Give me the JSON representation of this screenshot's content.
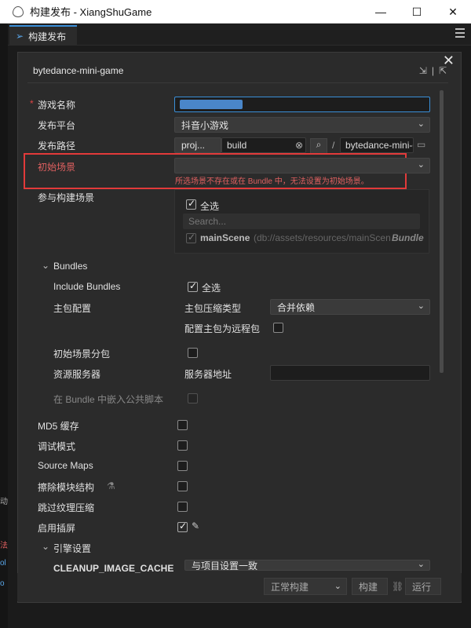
{
  "window": {
    "title": "构建发布 - XiangShuGame",
    "controls": {
      "minimize": "—",
      "maximize": "☐",
      "close": "✕"
    }
  },
  "tab": {
    "label": "构建发布"
  },
  "left_fragments": [
    "动",
    "法",
    "ol",
    "o"
  ],
  "panel": {
    "platform_name": "bytedance-mini-game",
    "fields": {
      "game_name_label": "游戏名称",
      "game_name_value": "",
      "platform_label": "发布平台",
      "platform_value": "抖音小游戏",
      "path_label": "发布路径",
      "path_prefix": "proj...",
      "path_value": "build",
      "path_sep": "/",
      "path_suffix": "bytedance-mini-g",
      "start_scene_label": "初始场景",
      "start_scene_value": "",
      "start_scene_error": "所选场景不存在或在 Bundle 中，无法设置为初始场景。",
      "scenes_label": "参与构建场景",
      "select_all": "全选",
      "search_placeholder": "Search...",
      "scene_name": "mainScene",
      "scene_path": "(db://assets/resources/mainScen",
      "scene_tag": "Bundle"
    },
    "bundles": {
      "section_label": "Bundles",
      "include_label": "Include Bundles",
      "include_select_all": "全选",
      "main_pkg_label": "主包配置",
      "compress_type_label": "主包压缩类型",
      "compress_type_value": "合并依赖",
      "remote_label": "配置主包为远程包",
      "start_scene_subpkg_label": "初始场景分包",
      "resource_server_label": "资源服务器",
      "server_addr_label": "服务器地址",
      "server_addr_value": "",
      "embed_script_label": "在 Bundle 中嵌入公共脚本"
    },
    "options": {
      "md5": "MD5 缓存",
      "debug": "调试模式",
      "source_maps": "Source Maps",
      "erase_modules": "擦除模块结构",
      "skip_texture": "跳过纹理压缩",
      "splash": "启用插屏"
    },
    "engine": {
      "section_label": "引擎设置",
      "cleanup_label": "CLEANUP_IMAGE_CACHE",
      "cleanup_value": "与项目设置一致"
    }
  },
  "footer": {
    "mode": "正常构建",
    "build": "构建",
    "run": "运行"
  },
  "colors": {
    "accent": "#3a8fd8",
    "error": "#e23a3a"
  }
}
